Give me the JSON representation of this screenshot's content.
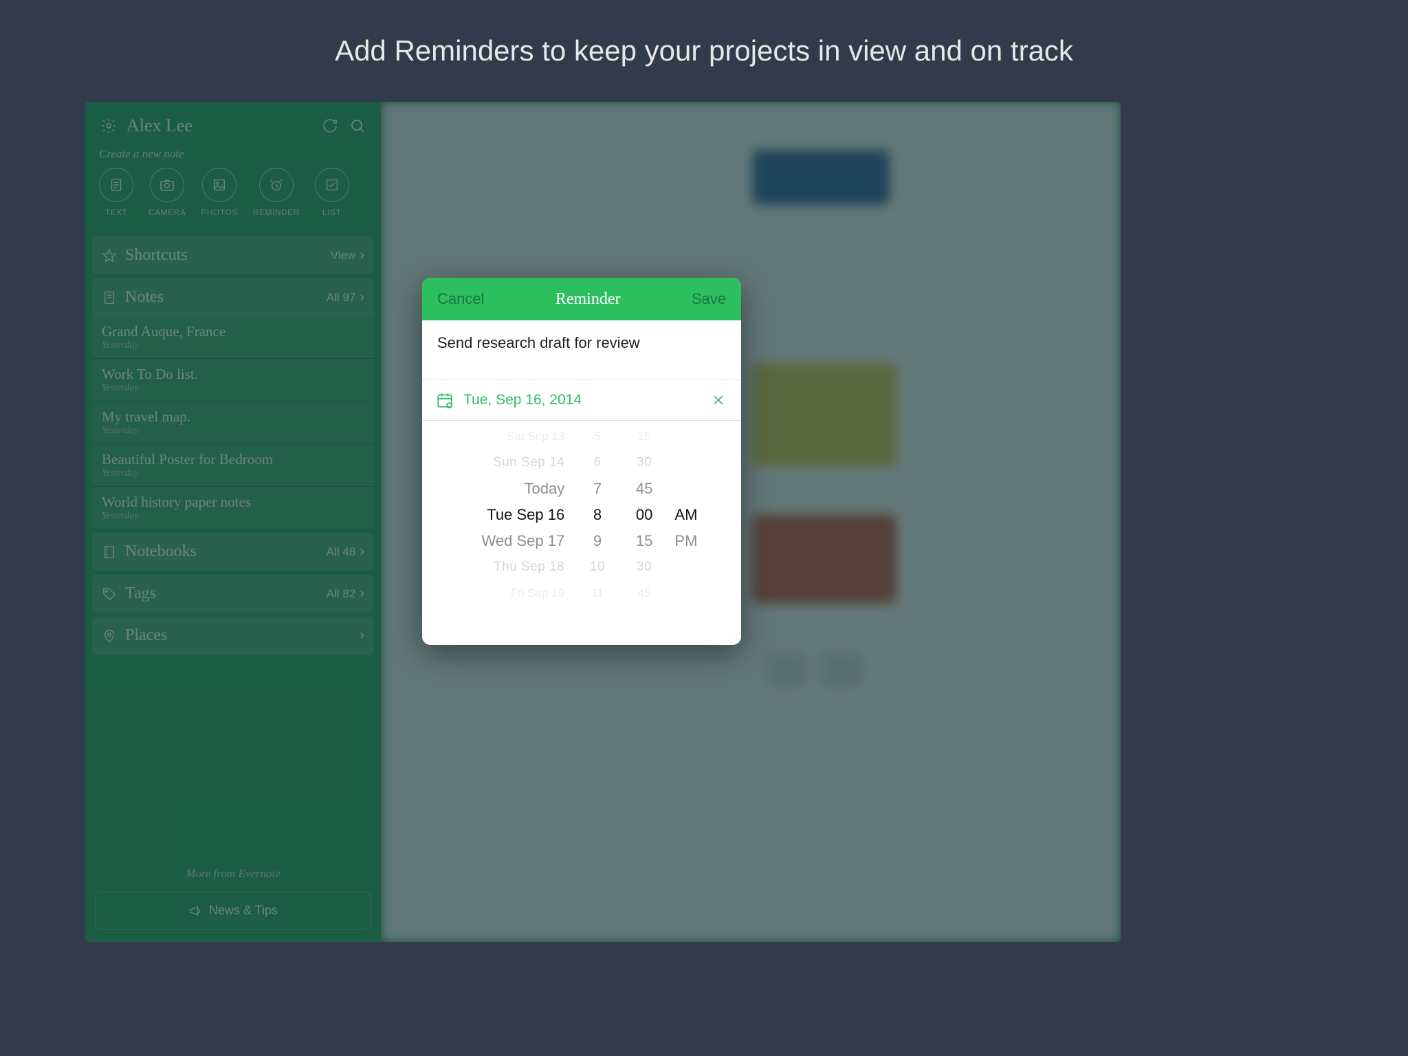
{
  "page_heading": "Add Reminders to keep your projects in view and on track",
  "sidebar": {
    "username": "Alex Lee",
    "create_label": "Create a new note",
    "new_note_types": [
      {
        "label": "TEXT",
        "icon": "text-icon"
      },
      {
        "label": "CAMERA",
        "icon": "camera-icon"
      },
      {
        "label": "PHOTOS",
        "icon": "photos-icon"
      },
      {
        "label": "REMINDER",
        "icon": "reminder-icon"
      },
      {
        "label": "LIST",
        "icon": "list-icon"
      }
    ],
    "shortcuts": {
      "title": "Shortcuts",
      "right": "View"
    },
    "notes_section": {
      "title": "Notes",
      "right": "All 97"
    },
    "notes": [
      {
        "title": "Grand Auque, France",
        "sub": "Yesterday"
      },
      {
        "title": "Work To Do list.",
        "sub": "Yesterday"
      },
      {
        "title": "My travel map.",
        "sub": "Yesterday"
      },
      {
        "title": "Beautiful  Poster for Bedroom",
        "sub": "Yesterday"
      },
      {
        "title": "World history paper notes",
        "sub": "Yesterday"
      }
    ],
    "notebooks": {
      "title": "Notebooks",
      "right": "All 48"
    },
    "tags": {
      "title": "Tags",
      "right": "All 82"
    },
    "places": {
      "title": "Places",
      "right": ""
    },
    "footer": {
      "more": "More from Evernote",
      "news": "News & Tips"
    }
  },
  "modal": {
    "cancel": "Cancel",
    "title": "Reminder",
    "save": "Save",
    "note_title": "Send research draft for review",
    "date_text": "Tue, Sep 16, 2014",
    "picker": {
      "days": [
        "Sat Sep 13",
        "Sun Sep 14",
        "Today",
        "Tue Sep 16",
        "Wed Sep 17",
        "Thu Sep 18",
        "Fri Sep 19"
      ],
      "hours": [
        "5",
        "6",
        "7",
        "8",
        "9",
        "10",
        "11"
      ],
      "minutes": [
        "15",
        "30",
        "45",
        "00",
        "15",
        "30",
        "45"
      ],
      "ampm": [
        "AM",
        "PM"
      ],
      "selected_index": 3
    }
  }
}
